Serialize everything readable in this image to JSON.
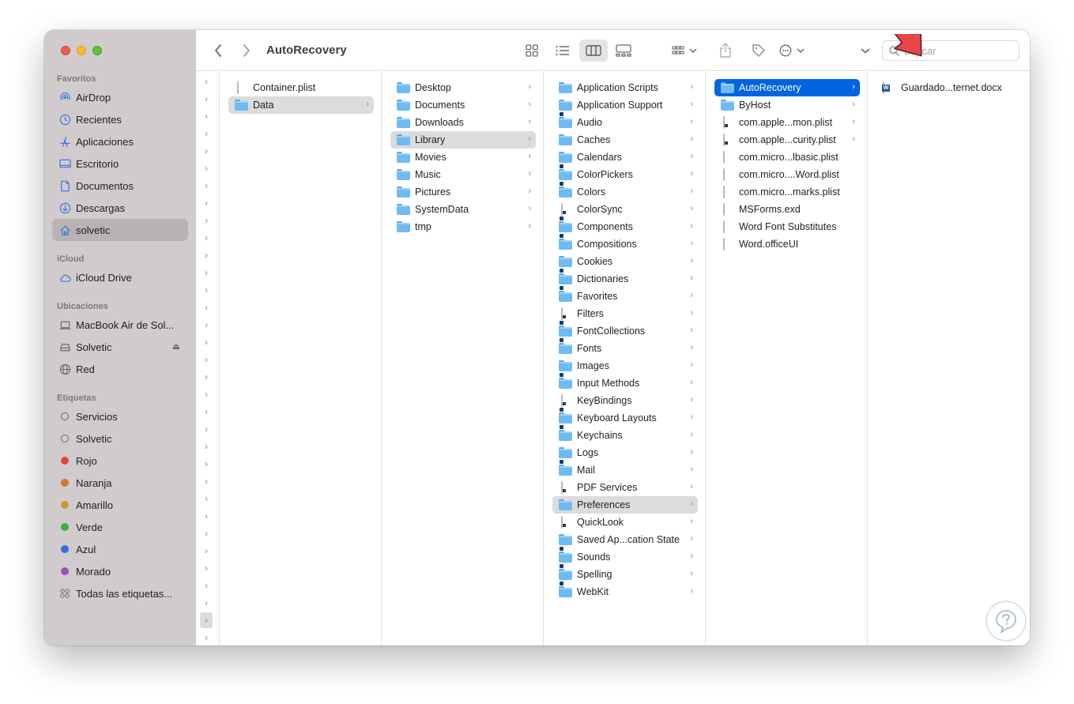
{
  "window": {
    "title": "AutoRecovery"
  },
  "sidebar": {
    "sections": {
      "favorites": "Favoritos",
      "icloud": "iCloud",
      "locations": "Ubicaciones",
      "tags": "Etiquetas"
    },
    "favorites": [
      {
        "label": "AirDrop",
        "icon": "airdrop-icon"
      },
      {
        "label": "Recientes",
        "icon": "clock-icon"
      },
      {
        "label": "Aplicaciones",
        "icon": "apps-icon"
      },
      {
        "label": "Escritorio",
        "icon": "desktop-icon"
      },
      {
        "label": "Documentos",
        "icon": "document-icon"
      },
      {
        "label": "Descargas",
        "icon": "download-icon"
      },
      {
        "label": "solvetic",
        "icon": "home-icon"
      }
    ],
    "icloud": [
      {
        "label": "iCloud Drive",
        "icon": "cloud-icon"
      }
    ],
    "locations": [
      {
        "label": "MacBook Air de Sol...",
        "icon": "laptop-icon"
      },
      {
        "label": "Solvetic",
        "icon": "drive-icon"
      },
      {
        "label": "Red",
        "icon": "globe-icon"
      }
    ],
    "tags": [
      {
        "label": "Servicios",
        "color": "none"
      },
      {
        "label": "Solvetic",
        "color": "none"
      },
      {
        "label": "Rojo",
        "color": "#e5433e"
      },
      {
        "label": "Naranja",
        "color": "#d4762c"
      },
      {
        "label": "Amarillo",
        "color": "#c99a2e"
      },
      {
        "label": "Verde",
        "color": "#3fae3a"
      },
      {
        "label": "Azul",
        "color": "#2f6fe0"
      },
      {
        "label": "Morado",
        "color": "#9b4fbf"
      },
      {
        "label": "Todas las etiquetas...",
        "color": "all"
      }
    ]
  },
  "toolbar": {
    "search_placeholder": "Buscar"
  },
  "columns": {
    "c1": [
      {
        "name": "Container.plist",
        "kind": "doc"
      },
      {
        "name": "Data",
        "kind": "folder",
        "selected": "grey",
        "chevron": true
      }
    ],
    "c2": [
      {
        "name": "Desktop",
        "kind": "folder",
        "chevron": true
      },
      {
        "name": "Documents",
        "kind": "folder",
        "chevron": true
      },
      {
        "name": "Downloads",
        "kind": "folder",
        "chevron": true
      },
      {
        "name": "Library",
        "kind": "folder",
        "chevron": true,
        "selected": "grey"
      },
      {
        "name": "Movies",
        "kind": "folder",
        "chevron": true
      },
      {
        "name": "Music",
        "kind": "folder",
        "chevron": true
      },
      {
        "name": "Pictures",
        "kind": "folder",
        "chevron": true
      },
      {
        "name": "SystemData",
        "kind": "folder",
        "chevron": true
      },
      {
        "name": "tmp",
        "kind": "folder",
        "chevron": true
      }
    ],
    "c3": [
      {
        "name": "Application Scripts",
        "kind": "folder",
        "chevron": true
      },
      {
        "name": "Application Support",
        "kind": "folder",
        "chevron": true
      },
      {
        "name": "Audio",
        "kind": "alias-folder",
        "chevron": true
      },
      {
        "name": "Caches",
        "kind": "folder",
        "chevron": true
      },
      {
        "name": "Calendars",
        "kind": "folder",
        "chevron": true
      },
      {
        "name": "ColorPickers",
        "kind": "alias-folder",
        "chevron": true
      },
      {
        "name": "Colors",
        "kind": "alias-folder",
        "chevron": true
      },
      {
        "name": "ColorSync",
        "kind": "alias-doc",
        "chevron": true
      },
      {
        "name": "Components",
        "kind": "alias-folder",
        "chevron": true
      },
      {
        "name": "Compositions",
        "kind": "alias-folder",
        "chevron": true
      },
      {
        "name": "Cookies",
        "kind": "folder",
        "chevron": true
      },
      {
        "name": "Dictionaries",
        "kind": "alias-folder",
        "chevron": true
      },
      {
        "name": "Favorites",
        "kind": "alias-folder",
        "chevron": true
      },
      {
        "name": "Filters",
        "kind": "alias-doc",
        "chevron": true
      },
      {
        "name": "FontCollections",
        "kind": "alias-folder",
        "chevron": true
      },
      {
        "name": "Fonts",
        "kind": "alias-folder",
        "chevron": true
      },
      {
        "name": "Images",
        "kind": "folder",
        "chevron": true
      },
      {
        "name": "Input Methods",
        "kind": "alias-folder",
        "chevron": true
      },
      {
        "name": "KeyBindings",
        "kind": "alias-doc",
        "chevron": true
      },
      {
        "name": "Keyboard Layouts",
        "kind": "alias-folder",
        "chevron": true
      },
      {
        "name": "Keychains",
        "kind": "alias-folder",
        "chevron": true
      },
      {
        "name": "Logs",
        "kind": "folder",
        "chevron": true
      },
      {
        "name": "Mail",
        "kind": "alias-folder",
        "chevron": true
      },
      {
        "name": "PDF Services",
        "kind": "alias-doc",
        "chevron": true
      },
      {
        "name": "Preferences",
        "kind": "folder",
        "chevron": true,
        "selected": "grey"
      },
      {
        "name": "QuickLook",
        "kind": "alias-doc",
        "chevron": true
      },
      {
        "name": "Saved Ap...cation State",
        "kind": "folder",
        "chevron": true
      },
      {
        "name": "Sounds",
        "kind": "alias-folder",
        "chevron": true
      },
      {
        "name": "Spelling",
        "kind": "alias-folder",
        "chevron": true
      },
      {
        "name": "WebKit",
        "kind": "alias-folder",
        "chevron": true
      }
    ],
    "c4": [
      {
        "name": "AutoRecovery",
        "kind": "folder",
        "chevron": true,
        "selected": "blue"
      },
      {
        "name": "ByHost",
        "kind": "folder",
        "chevron": true
      },
      {
        "name": "com.apple...mon.plist",
        "kind": "alias-doc",
        "chevron": true
      },
      {
        "name": "com.apple...curity.plist",
        "kind": "alias-doc",
        "chevron": true
      },
      {
        "name": "com.micro...lbasic.plist",
        "kind": "doc"
      },
      {
        "name": "com.micro....Word.plist",
        "kind": "doc"
      },
      {
        "name": "com.micro...marks.plist",
        "kind": "doc"
      },
      {
        "name": "MSForms.exd",
        "kind": "doc"
      },
      {
        "name": "Word Font Substitutes",
        "kind": "doc"
      },
      {
        "name": "Word.officeUI",
        "kind": "doc"
      }
    ],
    "c5": [
      {
        "name": "Guardado...ternet.docx",
        "kind": "word"
      }
    ]
  }
}
